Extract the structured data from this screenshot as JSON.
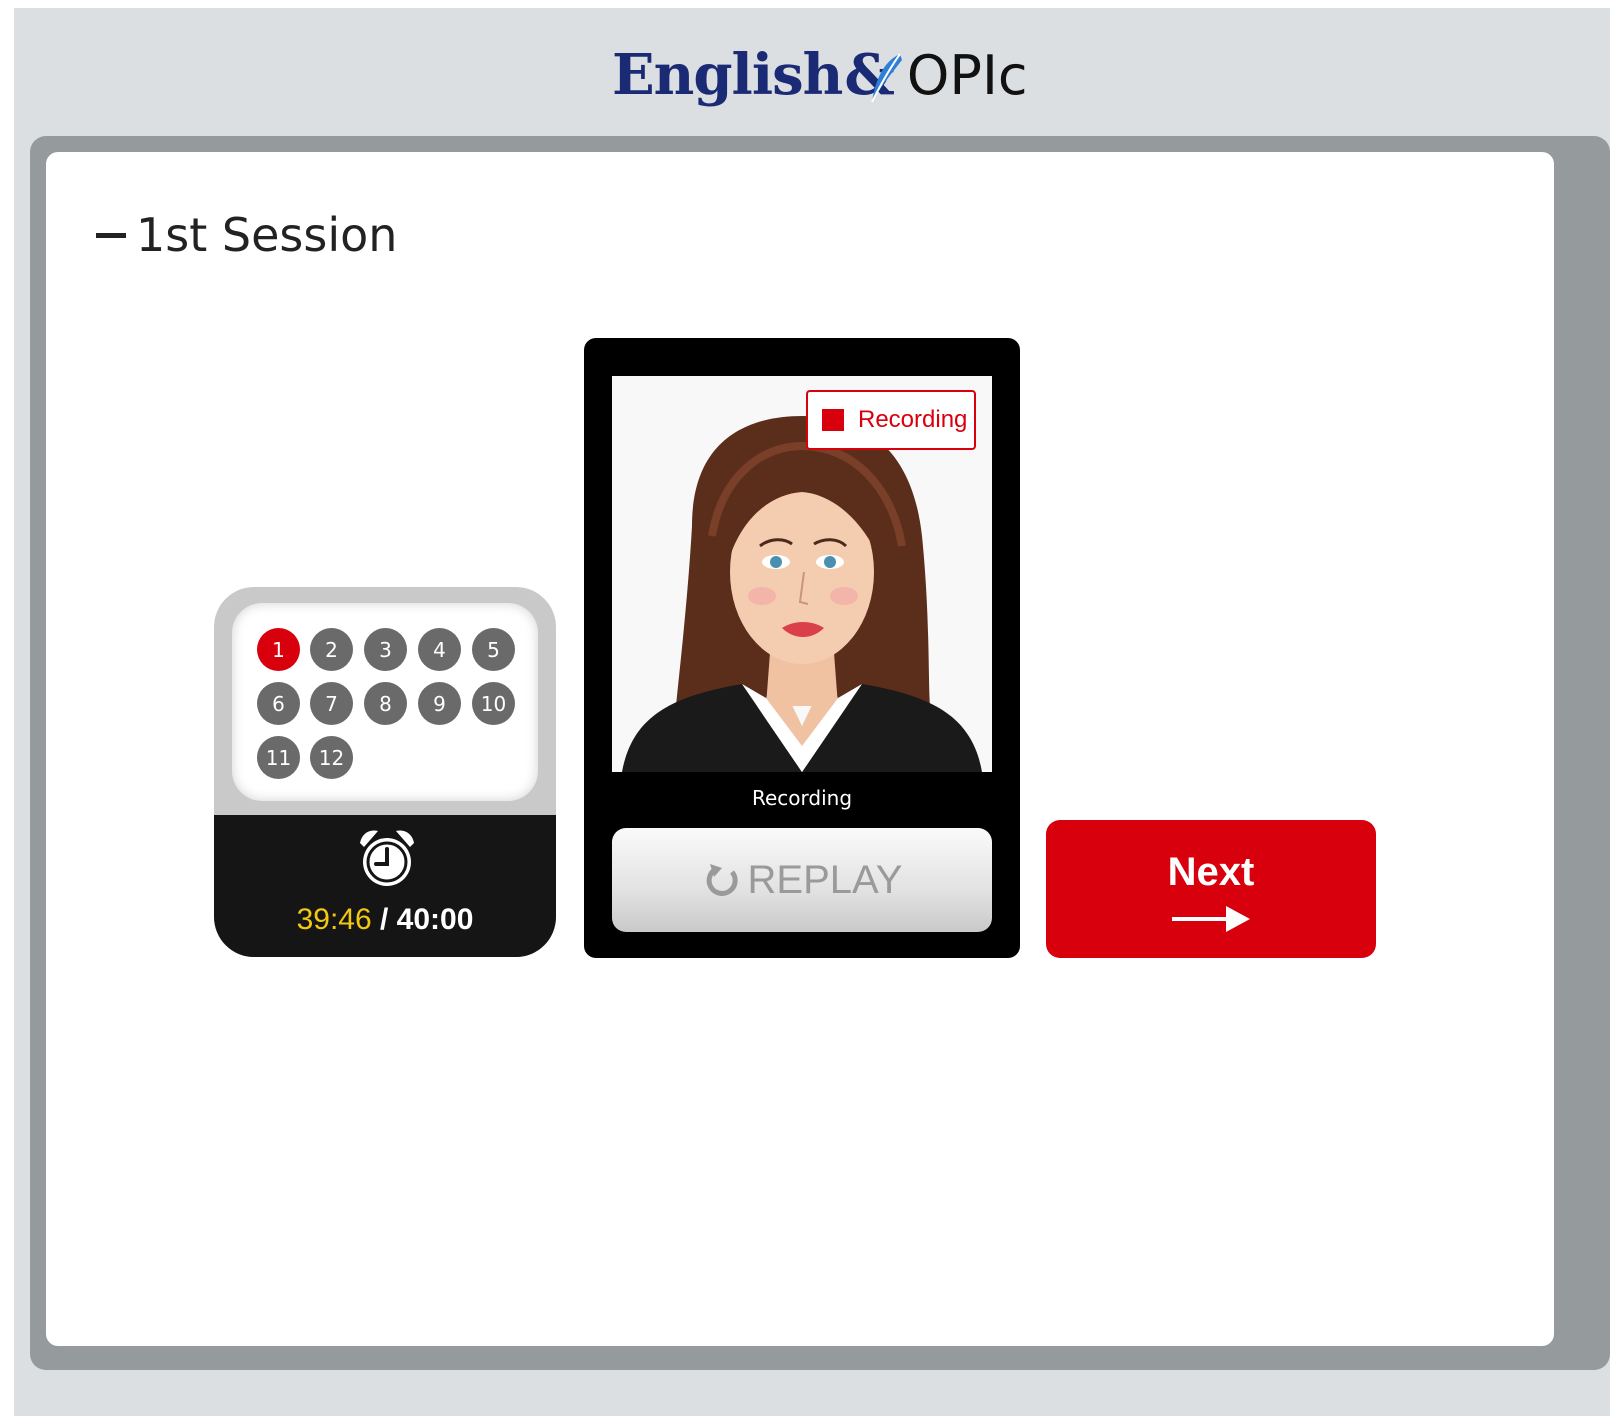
{
  "header": {
    "brand": "English",
    "brand_amp": "&",
    "product": "OPIc"
  },
  "session": {
    "title": "1st Session"
  },
  "progress": {
    "questions": [
      "1",
      "2",
      "3",
      "4",
      "5",
      "6",
      "7",
      "8",
      "9",
      "10",
      "11",
      "12"
    ],
    "current_question": "1",
    "timer": {
      "elapsed": "39:46",
      "separator": " / ",
      "total": "40:00"
    }
  },
  "video": {
    "badge_label": "Recording",
    "status_text": "Recording",
    "replay_label": "REPLAY"
  },
  "next_button": {
    "label": "Next"
  },
  "colors": {
    "accent_red": "#d9000d",
    "brand_navy": "#1b2a74",
    "timer_yellow": "#f2c811"
  }
}
